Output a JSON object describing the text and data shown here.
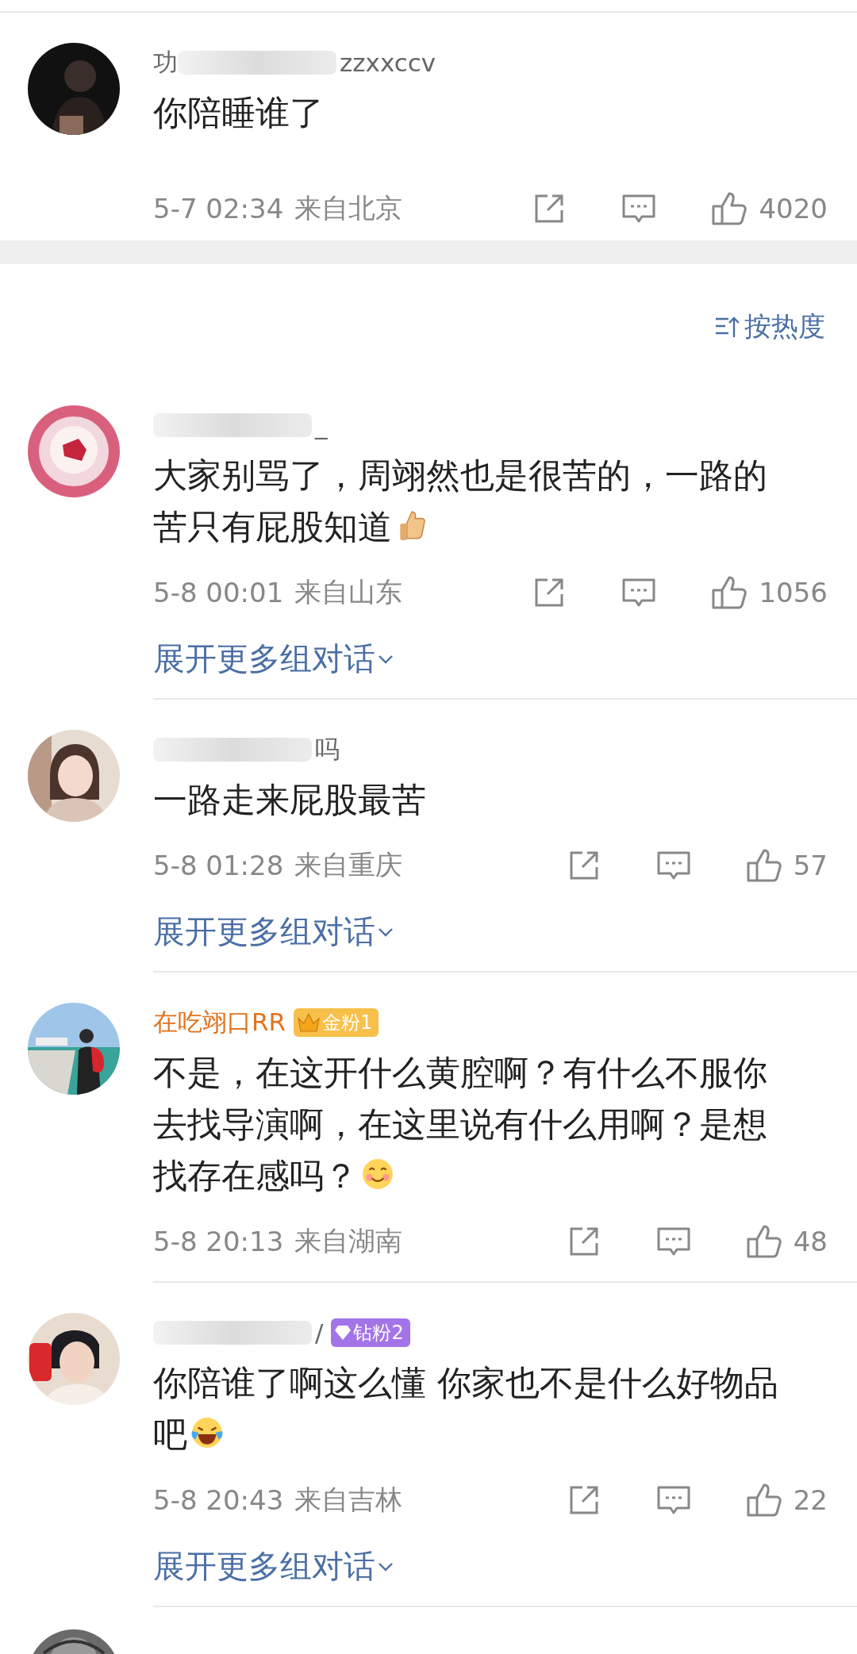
{
  "top_comment": {
    "name": [
      {
        "kind": "text",
        "text": "功"
      },
      {
        "kind": "blur"
      },
      {
        "kind": "text",
        "text": "zzxxccv"
      }
    ],
    "vip": false,
    "text": "你陪睡谁了",
    "time": "5-7 02:34",
    "location": "来自北京",
    "likes": "4020"
  },
  "sort": {
    "label": "按热度"
  },
  "comments": [
    {
      "name": [
        {
          "kind": "blur"
        },
        {
          "kind": "text",
          "text": "_"
        }
      ],
      "vip": false,
      "text": "大家别骂了，周翊然也是很苦的，一路的苦只有屁股知道",
      "emoji": {
        "kind": "thumb"
      },
      "time": "5-8 00:01",
      "location": "来自山东",
      "likes": "1056",
      "expand": "展开更多组对话"
    },
    {
      "name": [
        {
          "kind": "blur"
        },
        {
          "kind": "text",
          "text": "吗"
        }
      ],
      "vip": false,
      "text": "一路走来屁股最苦",
      "time": "5-8 01:28",
      "location": "来自重庆",
      "likes": "57",
      "expand": "展开更多组对话"
    },
    {
      "name": [
        {
          "kind": "text",
          "text": "在吃翊口RR"
        }
      ],
      "vip": true,
      "badge": {
        "kind": "gold",
        "text": "金粉1"
      },
      "text": "不是，在这开什么黄腔啊？有什么不服你去找导演啊，在这里说有什么用啊？是想找存在感吗？",
      "emoji": {
        "kind": "smile"
      },
      "time": "5-8 20:13",
      "location": "来自湖南",
      "likes": "48"
    },
    {
      "name": [
        {
          "kind": "blur"
        },
        {
          "kind": "text",
          "text": "/"
        }
      ],
      "vip": false,
      "badge": {
        "kind": "diamond",
        "text": "钻粉2"
      },
      "text": "你陪谁了啊这么懂 你家也不是什么好物品吧",
      "emoji": {
        "kind": "laugh"
      },
      "time": "5-8 20:43",
      "location": "来自吉林",
      "likes": "22",
      "expand": "展开更多组对话"
    }
  ]
}
